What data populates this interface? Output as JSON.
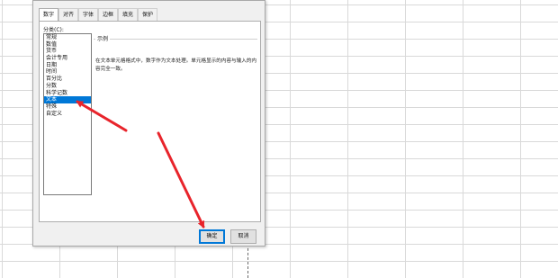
{
  "dialog": {
    "tabs": [
      {
        "label": "数字",
        "active": true
      },
      {
        "label": "对齐",
        "active": false
      },
      {
        "label": "字体",
        "active": false
      },
      {
        "label": "边框",
        "active": false
      },
      {
        "label": "填充",
        "active": false
      },
      {
        "label": "保护",
        "active": false
      }
    ],
    "category_label": "分类(C):",
    "categories": [
      "常规",
      "数值",
      "货币",
      "会计专用",
      "日期",
      "时间",
      "百分比",
      "分数",
      "科学记数",
      "文本",
      "特殊",
      "自定义"
    ],
    "selected_category": "文本",
    "sample_title": "示例",
    "description": "在文本单元格格式中，数字作为文本处理。单元格显示的内容与输入的内容完全一致。",
    "ok_label": "确定",
    "cancel_label": "取消"
  },
  "colors": {
    "selection": "#0078d7",
    "arrow": "#e8242b",
    "dialog_bg": "#f0f0f0"
  }
}
